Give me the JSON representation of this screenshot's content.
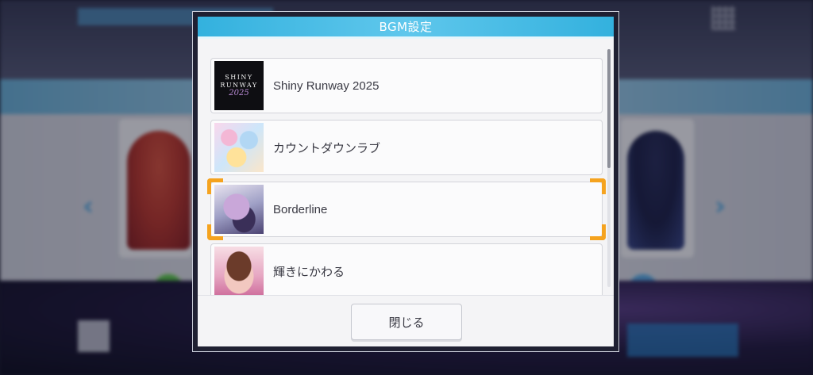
{
  "modal": {
    "title": "BGM設定",
    "close_label": "閉じる"
  },
  "tracks": [
    {
      "name": "Shiny Runway 2025",
      "jacket_text_1": "SHINY",
      "jacket_text_2": "RUNWAY",
      "jacket_text_3": "2025",
      "selected": false
    },
    {
      "name": "カウントダウンラブ",
      "selected": false
    },
    {
      "name": "Borderline",
      "selected": true
    },
    {
      "name": "輝きにかわる",
      "selected": false
    }
  ],
  "colors": {
    "header_blue": "#33b1de",
    "selection_orange": "#f5a31f"
  }
}
